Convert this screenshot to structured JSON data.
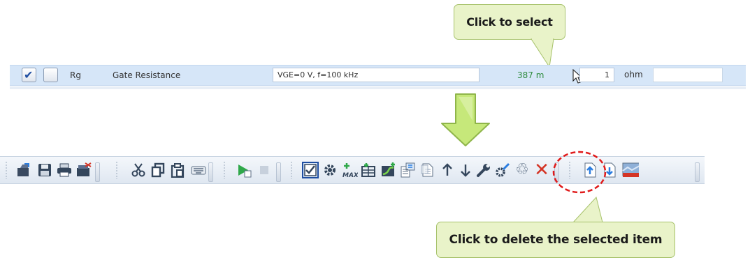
{
  "callouts": {
    "select": "Click to select",
    "delete": "Click to delete the selected item"
  },
  "param_row": {
    "name": "Rg",
    "description": "Gate Resistance",
    "condition": "VGE=0 V, f=100 kHz",
    "value": "387 m",
    "multiplier": "1",
    "unit": "ohm"
  },
  "toolbar": {
    "buttons": [
      "open-icon",
      "save-icon",
      "print-icon",
      "export-icon",
      "cut-icon",
      "copy-icon",
      "paste-icon",
      "keyboard-icon",
      "run-icon",
      "stop-icon",
      "select-all-icon",
      "settings-icon",
      "max-icon",
      "add-table-icon",
      "add-graph-icon",
      "import-icon",
      "document-icon",
      "move-up-icon",
      "move-down-icon",
      "wrench-icon",
      "edit-settings-icon",
      "recycle-icon",
      "delete-icon",
      "upload-icon",
      "download-icon",
      "image-icon"
    ]
  },
  "colors": {
    "callout_fill": "#e9f3c9",
    "row_highlight": "#d6e6f8",
    "value_text": "#2e8b3d",
    "delete_accent": "#d43425",
    "highlight_ellipse": "#e01b1b",
    "arrow_fill": "#c6e87a"
  }
}
